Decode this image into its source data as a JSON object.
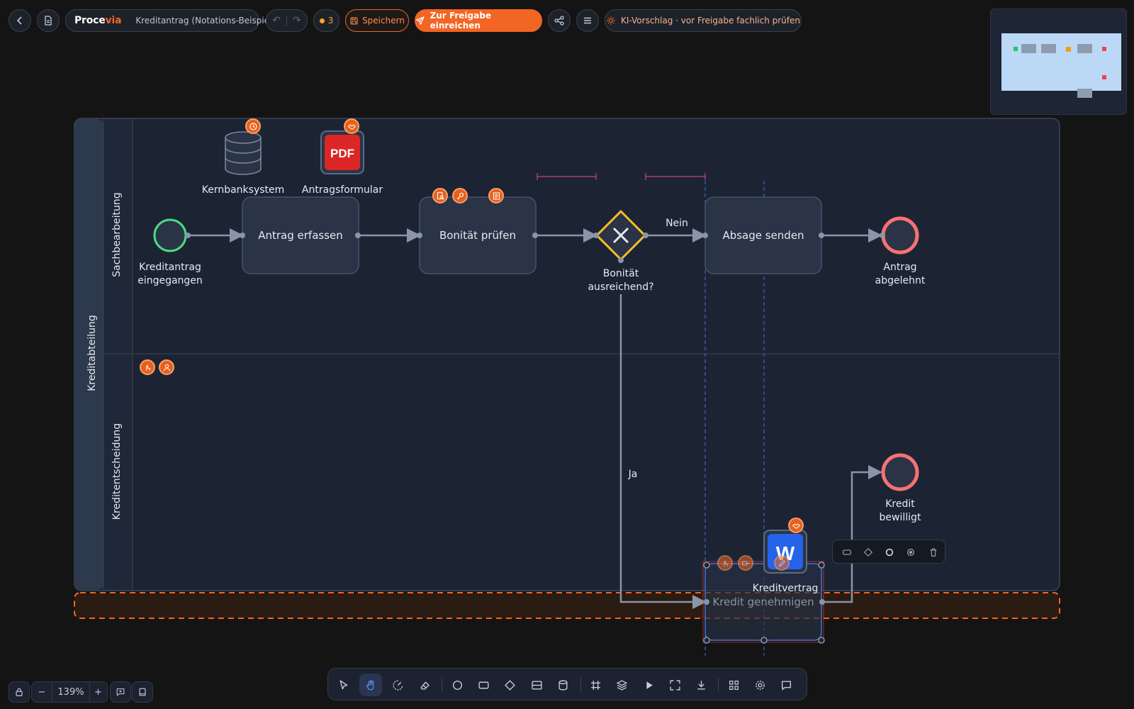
{
  "header": {
    "back_icon": "chevron-left-icon",
    "doc_icon": "document-icon",
    "brand_main": "Proce",
    "brand_accent": "via",
    "document_title": "Kreditantrag (Notations-Beispiel)",
    "undo_icon": "undo-icon",
    "redo_icon": "redo-icon",
    "issue_count": "3",
    "save_label": "Speichern",
    "submit_label": "Zur Freigabe einreichen",
    "share_icon": "share-icon",
    "menu_icon": "hamburger-menu-icon",
    "ki_label": "KI-Vorschlag · vor Freigabe fachlich prüfen"
  },
  "diagram": {
    "pool": "Kreditabteilung",
    "lanes": [
      "Sachbearbeitung",
      "Kreditentscheidung"
    ],
    "nodes": {
      "start": "Kreditantrag\neingegangen",
      "task1": "Antrag erfassen",
      "task2": "Bonität prüfen",
      "gateway": "Bonität\nausreichend?",
      "task3": "Absage senden",
      "end1": "Antrag\nabgelehnt",
      "end2": "Kredit\nbewilligt",
      "task4": "Kredit genehmigen",
      "data1": "Kernbanksystem",
      "data2": "Antragsformular",
      "data3": "Kreditvertrag"
    },
    "flow_labels": {
      "no": "Nein",
      "yes": "Ja"
    },
    "pdf_text": "PDF",
    "word_text": "W"
  },
  "zoom": {
    "value": "139%",
    "minus": "−",
    "plus": "+"
  },
  "toolbar": [
    "select-icon",
    "hand-icon",
    "lasso-icon",
    "eraser-icon",
    "circle-icon",
    "rectangle-icon",
    "diamond-icon",
    "lane-icon",
    "database-icon",
    "grid-icon",
    "layers-icon",
    "play-icon",
    "fullscreen-icon",
    "download-icon",
    "apps-icon",
    "settings-icon",
    "comment-icon"
  ],
  "colors": {
    "accent": "#f26522",
    "start_event": "#4ade80",
    "end_event": "#f87171",
    "gateway": "#fbbf24",
    "pool_bg": "#1c2434",
    "task_bg": "#2a3446",
    "guide": "#ec4899"
  }
}
